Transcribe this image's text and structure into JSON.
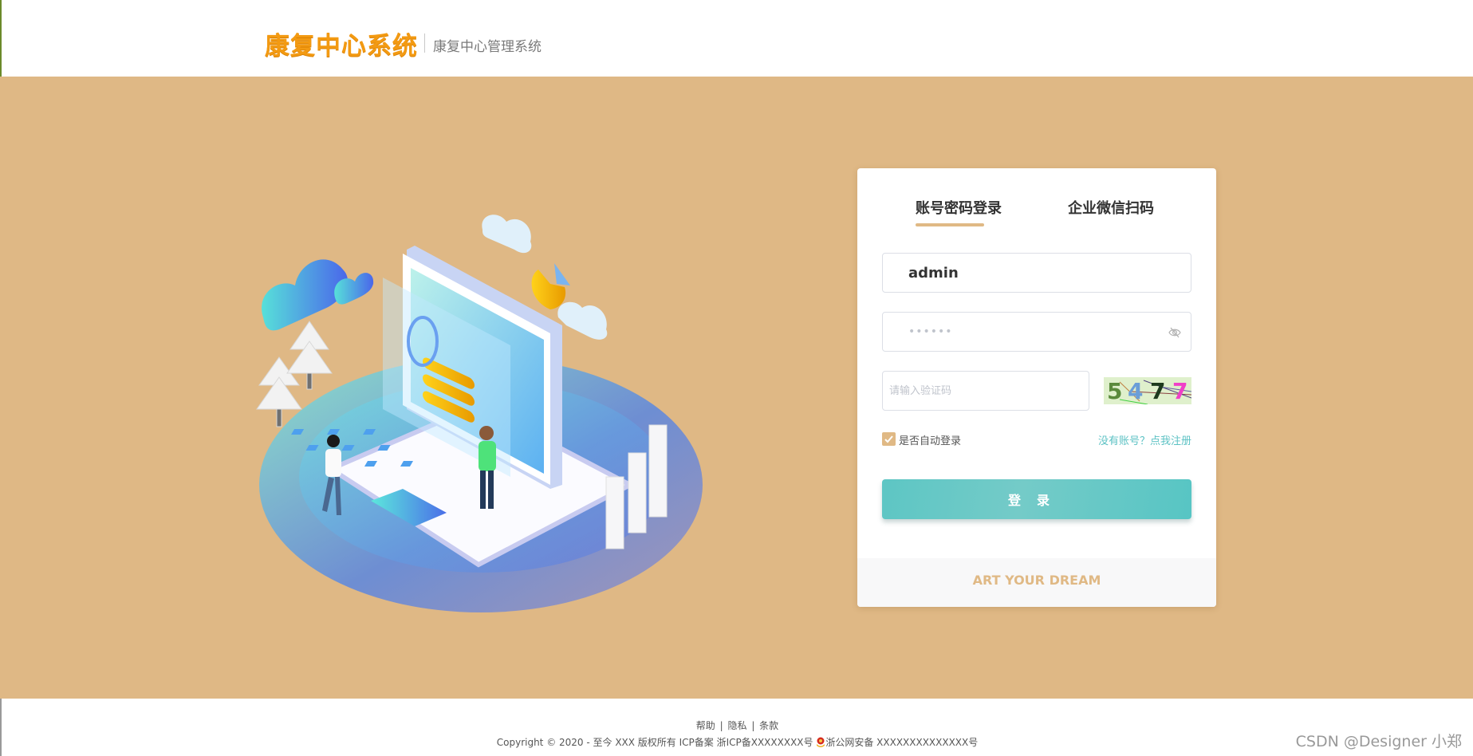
{
  "header": {
    "logo_text": "康复中心系统",
    "subtitle": "康复中心管理系统"
  },
  "login": {
    "tabs": [
      {
        "label": "账号密码登录",
        "active": true
      },
      {
        "label": "企业微信扫码",
        "active": false
      }
    ],
    "username": {
      "value": "admin"
    },
    "password": {
      "value": "••••••",
      "toggle_icon": "eye-off-icon"
    },
    "captcha": {
      "placeholder": "请输入验证码",
      "value": "",
      "image_chars": [
        "5",
        "4",
        "7",
        "7"
      ],
      "image_colors": [
        "#5a8a3c",
        "#6a9ed8",
        "#1d3a1d",
        "#f040c8"
      ]
    },
    "auto_login": {
      "label": "是否自动登录",
      "checked": true
    },
    "register_link": "没有账号？点我注册",
    "submit_label": "登录",
    "card_footer": "ART YOUR DREAM"
  },
  "footer": {
    "links": [
      "帮助",
      "隐私",
      "条款"
    ],
    "copyright": "Copyright © 2020 - 至今 XXX 版权所有 ICP备案 浙ICP备XXXXXXXX号",
    "police_record": "浙公网安备 XXXXXXXXXXXXXX号"
  },
  "watermark": "CSDN @Designer 小郑",
  "colors": {
    "background": "#dfb885",
    "accent": "#e0b985",
    "button": "#5dc6c4",
    "logo": "#f39a12",
    "link": "#5cc2c4"
  }
}
